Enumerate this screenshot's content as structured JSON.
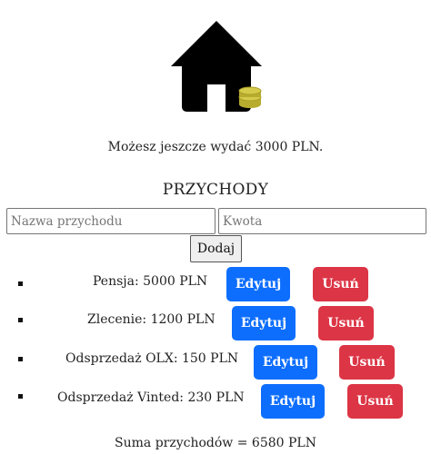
{
  "header": {
    "logo_icon": "house-with-coins-icon",
    "budget_text": "Możesz jeszcze wydać 3000 PLN."
  },
  "income": {
    "section_title": "PRZYCHODY",
    "name_placeholder": "Nazwa przychodu",
    "amount_placeholder": "Kwota",
    "add_label": "Dodaj",
    "items": [
      {
        "label": "Pensja: 5000 PLN",
        "edit_label": "Edytuj",
        "delete_label": "Usuń"
      },
      {
        "label": "Zlecenie: 1200 PLN",
        "edit_label": "Edytuj",
        "delete_label": "Usuń"
      },
      {
        "label": "Odsprzedaż OLX: 150 PLN",
        "edit_label": "Edytuj",
        "delete_label": "Usuń"
      },
      {
        "label": "Odsprzedaż Vinted: 230 PLN",
        "edit_label": "Edytuj",
        "delete_label": "Usuń"
      }
    ],
    "total_text": "Suma przychodów = 6580 PLN"
  },
  "colors": {
    "edit_button": "#0d6efd",
    "delete_button": "#dc3545",
    "coins": "#c9bd3a"
  }
}
